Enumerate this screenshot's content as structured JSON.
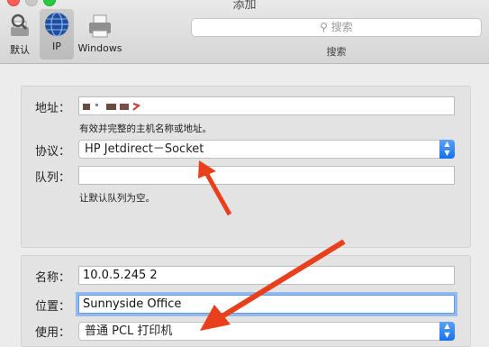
{
  "window": {
    "title": "添加"
  },
  "toolbar": {
    "default_label": "默认",
    "ip_label": "IP",
    "windows_label": "Windows"
  },
  "search": {
    "placeholder": "搜索",
    "label": "搜索"
  },
  "form1": {
    "address_label": "地址：",
    "address_value": "",
    "address_hint": "有效并完整的主机名称或地址。",
    "protocol_label": "协议：",
    "protocol_value": "HP Jetdirect－Socket",
    "queue_label": "队列：",
    "queue_value": "",
    "queue_hint": "让默认队列为空。"
  },
  "form2": {
    "name_label": "名称：",
    "name_value": "10.0.5.245 2",
    "location_label": "位置：",
    "location_value": "Sunnyside Office",
    "use_label": "使用：",
    "use_value": "普通 PCL 打印机"
  },
  "colors": {
    "accent": "#1670ee",
    "arrow": "#e8401c"
  }
}
